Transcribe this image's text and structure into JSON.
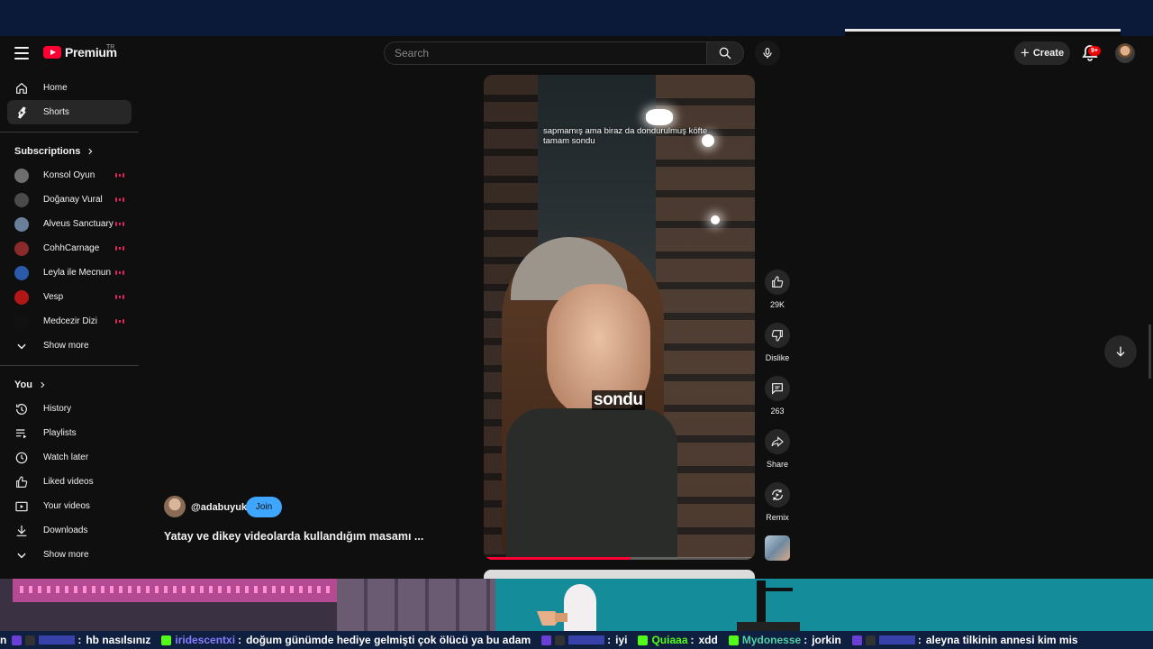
{
  "masthead": {
    "brand": "Premium",
    "brand_suffix": "TR",
    "search_placeholder": "Search",
    "create_label": "Create",
    "notification_count": "9+"
  },
  "sidebar": {
    "main": [
      {
        "label": "Home",
        "icon": "home-icon"
      },
      {
        "label": "Shorts",
        "icon": "shorts-icon",
        "active": true
      }
    ],
    "subscriptions_title": "Subscriptions",
    "subscriptions": [
      {
        "label": "Konsol Oyun",
        "avatar_color": "#6e6e6e",
        "live": true
      },
      {
        "label": "Doğanay Vural",
        "avatar_color": "#4a4a4a",
        "live": true
      },
      {
        "label": "Alveus Sanctuary",
        "avatar_color": "#6a7f9a",
        "live": true
      },
      {
        "label": "CohhCarnage",
        "avatar_color": "#8a2a2a",
        "live": true
      },
      {
        "label": "Leyla ile Mecnun",
        "avatar_color": "#2a5aa8",
        "live": true
      },
      {
        "label": "Vesp",
        "avatar_color": "#b01818",
        "live": true
      },
      {
        "label": "Medcezir Dizi",
        "avatar_color": "#111111",
        "live": true
      }
    ],
    "subscriptions_more": "Show more",
    "you_title": "You",
    "you": [
      {
        "label": "History",
        "icon": "history-icon"
      },
      {
        "label": "Playlists",
        "icon": "playlists-icon"
      },
      {
        "label": "Watch later",
        "icon": "watch-later-icon"
      },
      {
        "label": "Liked videos",
        "icon": "liked-videos-icon"
      },
      {
        "label": "Your videos",
        "icon": "your-videos-icon"
      },
      {
        "label": "Downloads",
        "icon": "downloads-icon"
      }
    ],
    "you_more": "Show more"
  },
  "short": {
    "caption_top": "sapmamış ama biraz da dondurulmuş köfte tamam sondu",
    "caption_big": "sondu",
    "progress": 0.54,
    "channel": "@adabuyuk",
    "join_label": "Join",
    "title": "Yatay ve dikey videolarda kullandığım masamı ..."
  },
  "actions": {
    "like_count": "29K",
    "dislike_label": "Dislike",
    "comment_count": "263",
    "share_label": "Share",
    "remix_label": "Remix"
  },
  "ticker": [
    {
      "user": "",
      "color": "#5b5bff",
      "text": "hb nasılsınız",
      "badges": [
        "#6a3fd6",
        "#333333"
      ]
    },
    {
      "user": "iridescentxi",
      "color": "#8a7dff",
      "text": "doğum günümde hediye gelmişti  çok ölücü ya bu adam",
      "badges": [
        "#53fc18"
      ]
    },
    {
      "user": "",
      "color": "#5b5bff",
      "text": "iyi",
      "badges": [
        "#6a3fd6",
        "#333333"
      ]
    },
    {
      "user": "Quiaaa",
      "color": "#53fc18",
      "text": "xdd",
      "badges": [
        "#53fc18"
      ]
    },
    {
      "user": "Mydonesse",
      "color": "#4fd1a5",
      "text": "jorkin",
      "badges": [
        "#53fc18"
      ]
    },
    {
      "user": "",
      "color": "#5b5bff",
      "text": "aleyna tilkinin annesi kim mis",
      "badges": [
        "#6a3fd6",
        "#333333"
      ]
    }
  ],
  "ticker_lead": "n"
}
